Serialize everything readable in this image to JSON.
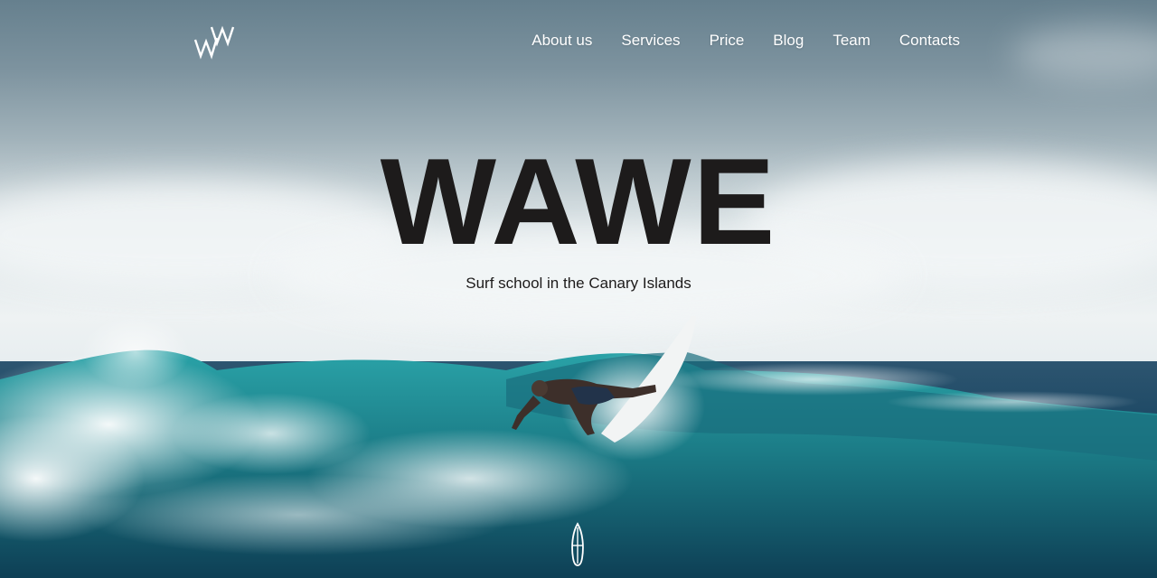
{
  "header": {
    "logo_icon": "wawe-logo-icon",
    "nav": [
      {
        "label": "About us"
      },
      {
        "label": "Services"
      },
      {
        "label": "Price"
      },
      {
        "label": "Blog"
      },
      {
        "label": "Team"
      },
      {
        "label": "Contacts"
      }
    ]
  },
  "hero": {
    "title": "WAWE",
    "subtitle": "Surf school in the Canary Islands",
    "scroll_icon": "surfboard-scroll-icon"
  },
  "colors": {
    "title_text": "#1d1b1b",
    "nav_text": "#ffffff",
    "sea": "#15405a",
    "wave_teal": "#1f8a94"
  }
}
